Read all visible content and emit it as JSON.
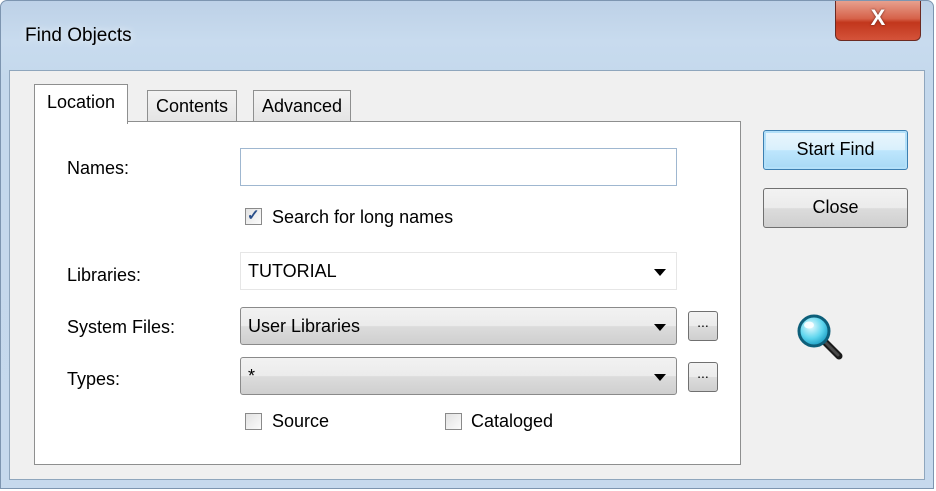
{
  "window": {
    "title": "Find Objects",
    "close_glyph": "X"
  },
  "tabs": [
    {
      "label": "Location",
      "active": true
    },
    {
      "label": "Contents",
      "active": false
    },
    {
      "label": "Advanced",
      "active": false
    }
  ],
  "form": {
    "names_label": "Names:",
    "names_value": "",
    "long_names_label": "Search for long names",
    "long_names_checked": true,
    "libraries_label": "Libraries:",
    "libraries_value": "TUTORIAL",
    "system_files_label": "System Files:",
    "system_files_value": "User Libraries",
    "types_label": "Types:",
    "types_value": "*",
    "browse_label": "...",
    "source_label": "Source",
    "source_checked": false,
    "cataloged_label": "Cataloged",
    "cataloged_checked": false
  },
  "buttons": {
    "start_find": "Start Find",
    "close": "Close"
  },
  "icons": {
    "close": "close-icon",
    "search": "magnifier-icon",
    "dropdown": "chevron-down-icon"
  }
}
